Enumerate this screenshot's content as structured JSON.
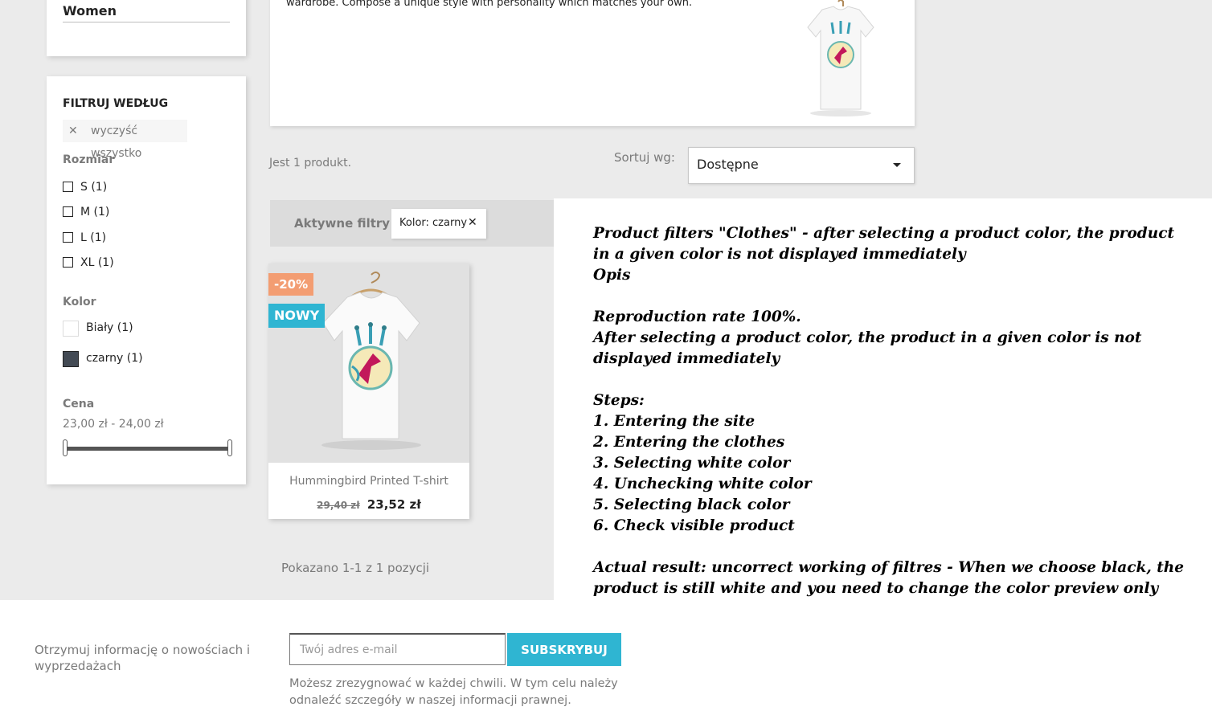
{
  "category_block": {
    "title": "Women"
  },
  "filters": {
    "title": "FILTRUJ WEDŁUG",
    "clear_all": "wyczyść wszystko",
    "size": {
      "title": "Rozmiar",
      "options": [
        "S (1)",
        "M (1)",
        "L (1)",
        "XL (1)"
      ]
    },
    "color": {
      "title": "Kolor",
      "options": [
        {
          "label": "Biały (1)",
          "swatch": "#ffffff"
        },
        {
          "label": "czarny (1)",
          "swatch": "#434a54"
        }
      ]
    },
    "price": {
      "title": "Cena",
      "range_text": "23,00 zł - 24,00 zł",
      "min": 23,
      "max": 24,
      "selected_min": 23,
      "selected_max": 24
    }
  },
  "banner": {
    "text": "wardrobe. Compose a unique style with personality which matches your own.",
    "image": "tshirt-image"
  },
  "listing": {
    "count_text": "Jest 1 produkt.",
    "sort_label": "Sortuj wg:",
    "sort_value": "Dostępne",
    "active_filters_label": "Aktywne filtry",
    "active_filter_chip": "Kolor: czarny",
    "pagination_text": "Pokazano 1-1 z 1 pozycji"
  },
  "product": {
    "flag_discount": "-20%",
    "flag_new": "NOWY",
    "name": "Hummingbird Printed T-shirt",
    "old_price": "29,40 zł",
    "price": "23,52 zł"
  },
  "annotation": {
    "lines": [
      "Product filters \"Clothes\" - after selecting a product color, the product in a given color is not displayed immediately",
      "Opis",
      "",
      "Reproduction rate 100%.",
      "After selecting a product color, the product in a given color is not displayed immediately",
      "",
      "Steps:",
      "1. Entering the site",
      "2. Entering the clothes",
      "3. Selecting white color",
      "4. Unchecking white color",
      "5. Selecting black color",
      "6. Check visible product",
      "",
      "Actual result: uncorrect working of filtres - When we choose black, the product is still white and you need to change the color preview only after hovering over the product."
    ]
  },
  "footer": {
    "newsletter_text": "Otrzymuj informację o nowościach i wyprzedażach",
    "email_placeholder": "Twój adres e-mail",
    "subscribe_label": "SUBSKRYBUJ",
    "legal_text": "Możesz zrezygnować w każdej chwili. W tym celu należy odnaleźć szczegóły w naszej informacji prawnej."
  },
  "colors": {
    "accent": "#2fb5d2",
    "discount": "#f39d72",
    "background": "#ebebeb"
  }
}
